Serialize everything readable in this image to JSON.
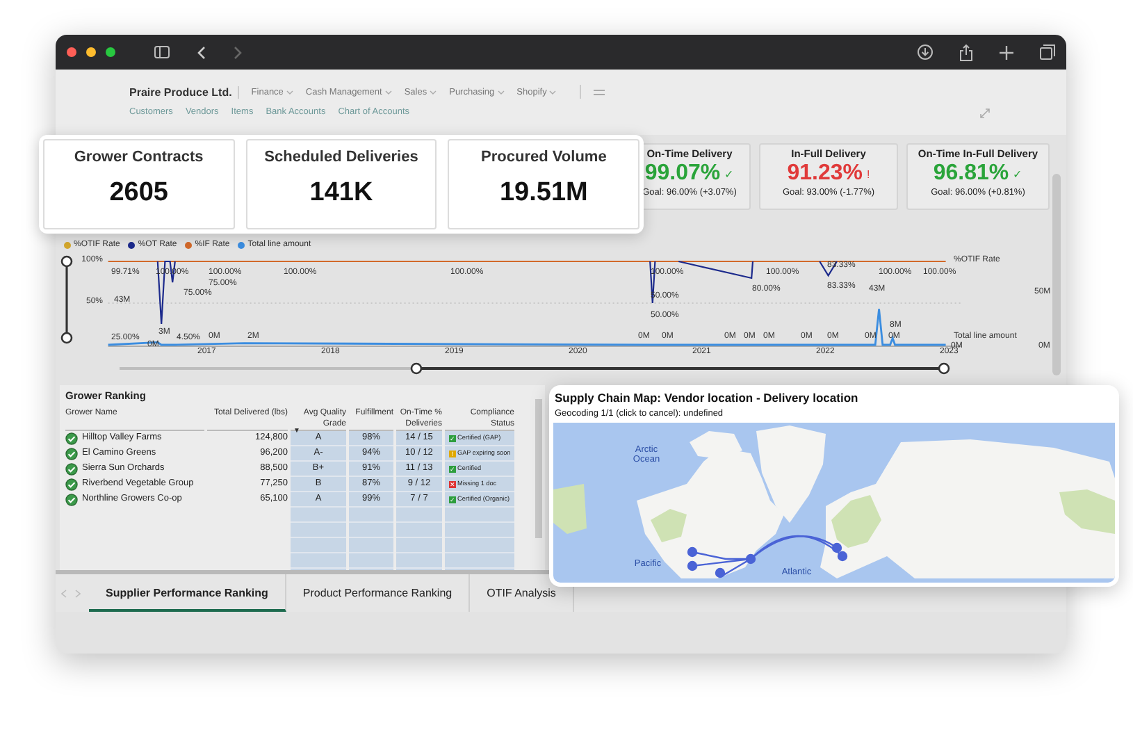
{
  "header": {
    "company": "Praire Produce Ltd.",
    "menus": [
      {
        "label": "Finance"
      },
      {
        "label": "Cash Management"
      },
      {
        "label": "Sales"
      },
      {
        "label": "Purchasing"
      },
      {
        "label": "Shopify"
      }
    ],
    "links": [
      "Customers",
      "Vendors",
      "Items",
      "Bank Accounts",
      "Chart of Accounts"
    ]
  },
  "summary_cards": [
    {
      "title": "Grower Contracts",
      "value": "2605"
    },
    {
      "title": "Scheduled Deliveries",
      "value": "141K"
    },
    {
      "title": "Procured Volume",
      "value": "19.51M"
    }
  ],
  "otif_cards": [
    {
      "title": "On-Time Delivery",
      "value": "99.07%",
      "color": "#2aa43a",
      "symbol": "✓",
      "goal": "Goal: 96.00% (+3.07%)"
    },
    {
      "title": "In-Full Delivery",
      "value": "91.23%",
      "color": "#e03a3a",
      "symbol": "!",
      "goal": "Goal: 93.00% (-1.77%)"
    },
    {
      "title": "On-Time In-Full Delivery",
      "value": "96.81%",
      "color": "#2aa43a",
      "symbol": "✓",
      "goal": "Goal: 96.00% (+0.81%)"
    }
  ],
  "chart": {
    "chart_data": {
      "type": "line",
      "x": [
        2016.2,
        2016.6,
        2016.63,
        2016.66,
        2016.7,
        2016.72,
        2016.74,
        2017.3,
        2020.58,
        2020.6,
        2020.62,
        2020.7,
        2020.81,
        2021.4,
        2021.41,
        2021.7,
        2021.95,
        2022.02,
        2022.09,
        2022.4,
        2022.43,
        2022.46,
        2022.52,
        2022.54,
        2022.56,
        2022.97
      ],
      "series": [
        {
          "name": "%OT Rate",
          "color": "#1c2a8c",
          "values": [
            null,
            100,
            25,
            100,
            100,
            75,
            100,
            null,
            100,
            50,
            100,
            null,
            100,
            80,
            100,
            null,
            100,
            83,
            100,
            null,
            null,
            null,
            null,
            null,
            null,
            null
          ]
        },
        {
          "name": "%IF Rate",
          "color": "#d2692a",
          "values": [
            100,
            100,
            100,
            100,
            100,
            100,
            100,
            100,
            100,
            100,
            100,
            100,
            100,
            100,
            100,
            100,
            100,
            100,
            100,
            100,
            100,
            100,
            100,
            100,
            100,
            100
          ]
        },
        {
          "name": "Total line amount",
          "color": "#3b8de0",
          "values": [
            0,
            3,
            0,
            0,
            0,
            0,
            0,
            2,
            0,
            0,
            0,
            0,
            0,
            0,
            0,
            0,
            0,
            0,
            0,
            0,
            43,
            0,
            0,
            8,
            0,
            0
          ]
        }
      ],
      "xlim": [
        2016.2,
        2023.1
      ],
      "ylim": [
        0,
        100
      ],
      "legend": "top-left",
      "xticks": [
        {
          "value": 2017,
          "label": "2017"
        },
        {
          "value": 2018,
          "label": "2018"
        },
        {
          "value": 2019,
          "label": "2019"
        },
        {
          "value": 2020,
          "label": "2020"
        },
        {
          "value": 2021,
          "label": "2021"
        },
        {
          "value": 2022,
          "label": "2022"
        },
        {
          "value": 2023,
          "label": "2023"
        }
      ],
      "yticks": [
        {
          "value": 100,
          "label": "100%"
        },
        {
          "value": 50,
          "label": "50%"
        }
      ]
    },
    "legend_extra": {
      "label": "%OTIF Rate",
      "color": "#d4a72c"
    },
    "right_labels": [
      "%OTIF Rate",
      "50M",
      "Total line amount",
      "0M"
    ],
    "point_labels": [
      "99.71%",
      "100.00%",
      "100.00%",
      "75.00%",
      "75.00%",
      "100.00%",
      "100.00%",
      "100.00%",
      "50.00%",
      "50.00%",
      "100.00%",
      "80.00%",
      "83.33%",
      "83.33%",
      "100.00%",
      "100.00%",
      "43M",
      "43M",
      "8M",
      "25.00%",
      "3M",
      "0M",
      "4.50%",
      "0M",
      "2M",
      "0M",
      "0M",
      "0M",
      "0M",
      "0M",
      "0M",
      "0M",
      "0M",
      "0M",
      "0M"
    ],
    "value_slider": {
      "low": {
        "level": 0
      },
      "high": {
        "level": 1
      }
    },
    "date_slider": {
      "low": {
        "level": 0.36
      },
      "high": {
        "level": 1
      }
    }
  },
  "grower_ranking": {
    "title": "Grower Ranking",
    "sort_symbol": "▼",
    "columns": [
      {
        "label": "Grower Name",
        "sorted": false
      },
      {
        "label": "Total Delivered (lbs)",
        "sorted": false
      },
      {
        "label": "Avg Quality Grade",
        "sorted": true
      },
      {
        "label": "Fulfillment",
        "sorted": false
      },
      {
        "label": "On-Time % Deliveries",
        "sorted": false
      },
      {
        "label": "Compliance Status",
        "sorted": false
      }
    ],
    "rows": [
      {
        "name": "Hilltop Valley Farms",
        "total": "124,800",
        "grade": "A",
        "fulfillment": "98%",
        "on_time": "14 / 15",
        "compliance": "Certified (GAP)",
        "icon": "✓",
        "color": "#2e9e3e"
      },
      {
        "name": "El Camino Greens",
        "total": "96,200",
        "grade": "A-",
        "fulfillment": "94%",
        "on_time": "10 / 12",
        "compliance": "GAP expiring soon",
        "icon": "!",
        "color": "#e0a800"
      },
      {
        "name": "Sierra Sun Orchards",
        "total": "88,500",
        "grade": "B+",
        "fulfillment": "91%",
        "on_time": "11 / 13",
        "compliance": "Certified",
        "icon": "✓",
        "color": "#2e9e3e"
      },
      {
        "name": "Riverbend Vegetable Group",
        "total": "77,250",
        "grade": "B",
        "fulfillment": "87%",
        "on_time": "9 / 12",
        "compliance": "Missing 1 doc",
        "icon": "✕",
        "color": "#dd3333"
      },
      {
        "name": "Northline Growers Co-op",
        "total": "65,100",
        "grade": "A",
        "fulfillment": "99%",
        "on_time": "7 / 7",
        "compliance": "Certified (Organic)",
        "icon": "✓",
        "color": "#2e9e3e"
      }
    ]
  },
  "sheet_tabs": [
    {
      "label": "Supplier Performance Ranking",
      "selected": true
    },
    {
      "label": "Product Performance Ranking",
      "selected": false
    },
    {
      "label": "OTIF Analysis",
      "selected": false
    }
  ],
  "map": {
    "title": "Supply Chain Map: Vendor location - Delivery location",
    "status": "Geocoding 1/1 (click to cancel): undefined",
    "labels": [
      "Arctic Ocean",
      "Pacific",
      "Atlantic"
    ]
  }
}
